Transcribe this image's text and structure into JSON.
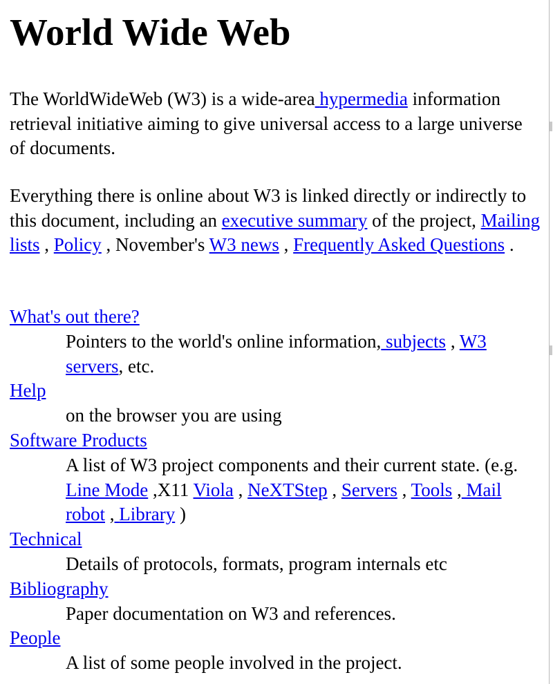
{
  "page": {
    "title": "World Wide Web",
    "intro": {
      "text1": "The WorldWideWeb (W3) is a wide-area",
      "link_hypermedia": "hypermedia",
      "text2": "information retrieval initiative aiming to give universal access to a large universe of documents."
    },
    "overview": {
      "text1": "Everything there is online about W3 is linked directly or indirectly to this document, including an",
      "link_exec_summary": "executive summary",
      "text2": "of the project,",
      "link_mailing_lists": "Mailing lists",
      "sep1": ",",
      "link_policy": "Policy",
      "text3": ", November's",
      "link_w3_news": "W3 news",
      "sep2": ",",
      "link_faq": "Frequently Asked Questions",
      "end": "."
    },
    "sections": {
      "whats_out_there": {
        "term": "What's out there?",
        "desc1": "Pointers to the world's online information,",
        "link_subjects": "subjects",
        "sep": ",",
        "link_w3_servers": "W3 servers",
        "desc2": ", etc."
      },
      "help": {
        "term": "Help",
        "desc": "on the browser you are using"
      },
      "software_products": {
        "term": "Software Products",
        "desc1": "A list of W3 project components and their current state. (e.g.",
        "link_line_mode": "Line Mode",
        "text_x11": ",X11",
        "link_viola": "Viola",
        "sep1": ",",
        "link_nextstep": "NeXTStep",
        "sep2": ",",
        "link_servers": "Servers",
        "sep3": ",",
        "link_tools": "Tools",
        "sep4": ",",
        "link_mail_robot": "Mail robot",
        "sep5": ",",
        "link_library": "Library",
        "end": ")"
      },
      "technical": {
        "term": "Technical",
        "desc": "Details of protocols, formats, program internals etc"
      },
      "bibliography": {
        "term": "Bibliography",
        "desc": "Paper documentation on W3 and references."
      },
      "people": {
        "term": "People",
        "desc": "A list of some people involved in the project."
      }
    }
  },
  "colors": {
    "link": "#0000ee",
    "text": "#000000",
    "background": "#ffffff"
  }
}
